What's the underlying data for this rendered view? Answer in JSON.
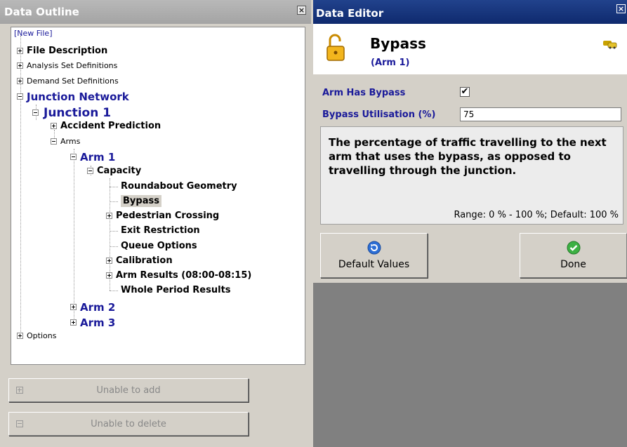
{
  "outline": {
    "title": "Data Outline",
    "close": "×",
    "tree": {
      "new_file": "[New File]",
      "file_description": "File Description",
      "analysis_sets": "Analysis Set Definitions",
      "demand_sets": "Demand Set Definitions",
      "junction_network": "Junction Network",
      "junction_1": "Junction 1",
      "accident_prediction": "Accident Prediction",
      "arms": "Arms",
      "arm_1": "Arm 1",
      "capacity": "Capacity",
      "roundabout_geometry": "Roundabout Geometry",
      "bypass": "Bypass",
      "pedestrian_crossing": "Pedestrian Crossing",
      "exit_restriction": "Exit Restriction",
      "queue_options": "Queue Options",
      "calibration": "Calibration",
      "arm_results": "Arm Results (08:00-08:15)",
      "whole_period_results": "Whole Period Results",
      "arm_2": "Arm 2",
      "arm_3": "Arm 3",
      "options": "Options"
    },
    "add_label": "Unable to add",
    "delete_label": "Unable to delete"
  },
  "editor": {
    "title": "Data Editor",
    "close": "×",
    "heading": "Bypass",
    "subheading": "(Arm 1)",
    "fields": {
      "has_bypass_label": "Arm Has Bypass",
      "has_bypass_checked": "✔",
      "utilisation_label": "Bypass Utilisation (%)",
      "utilisation_value": "75"
    },
    "description": "The percentage of traffic travelling to the next arm that uses the bypass, as opposed to travelling through the junction.",
    "range": "Range: 0 % - 100 %; Default: 100 %",
    "default_values_label": "Default Values",
    "done_label": "Done",
    "colors": {
      "accent": "#1a1a9a",
      "title_bar": "#1f3d86"
    }
  }
}
